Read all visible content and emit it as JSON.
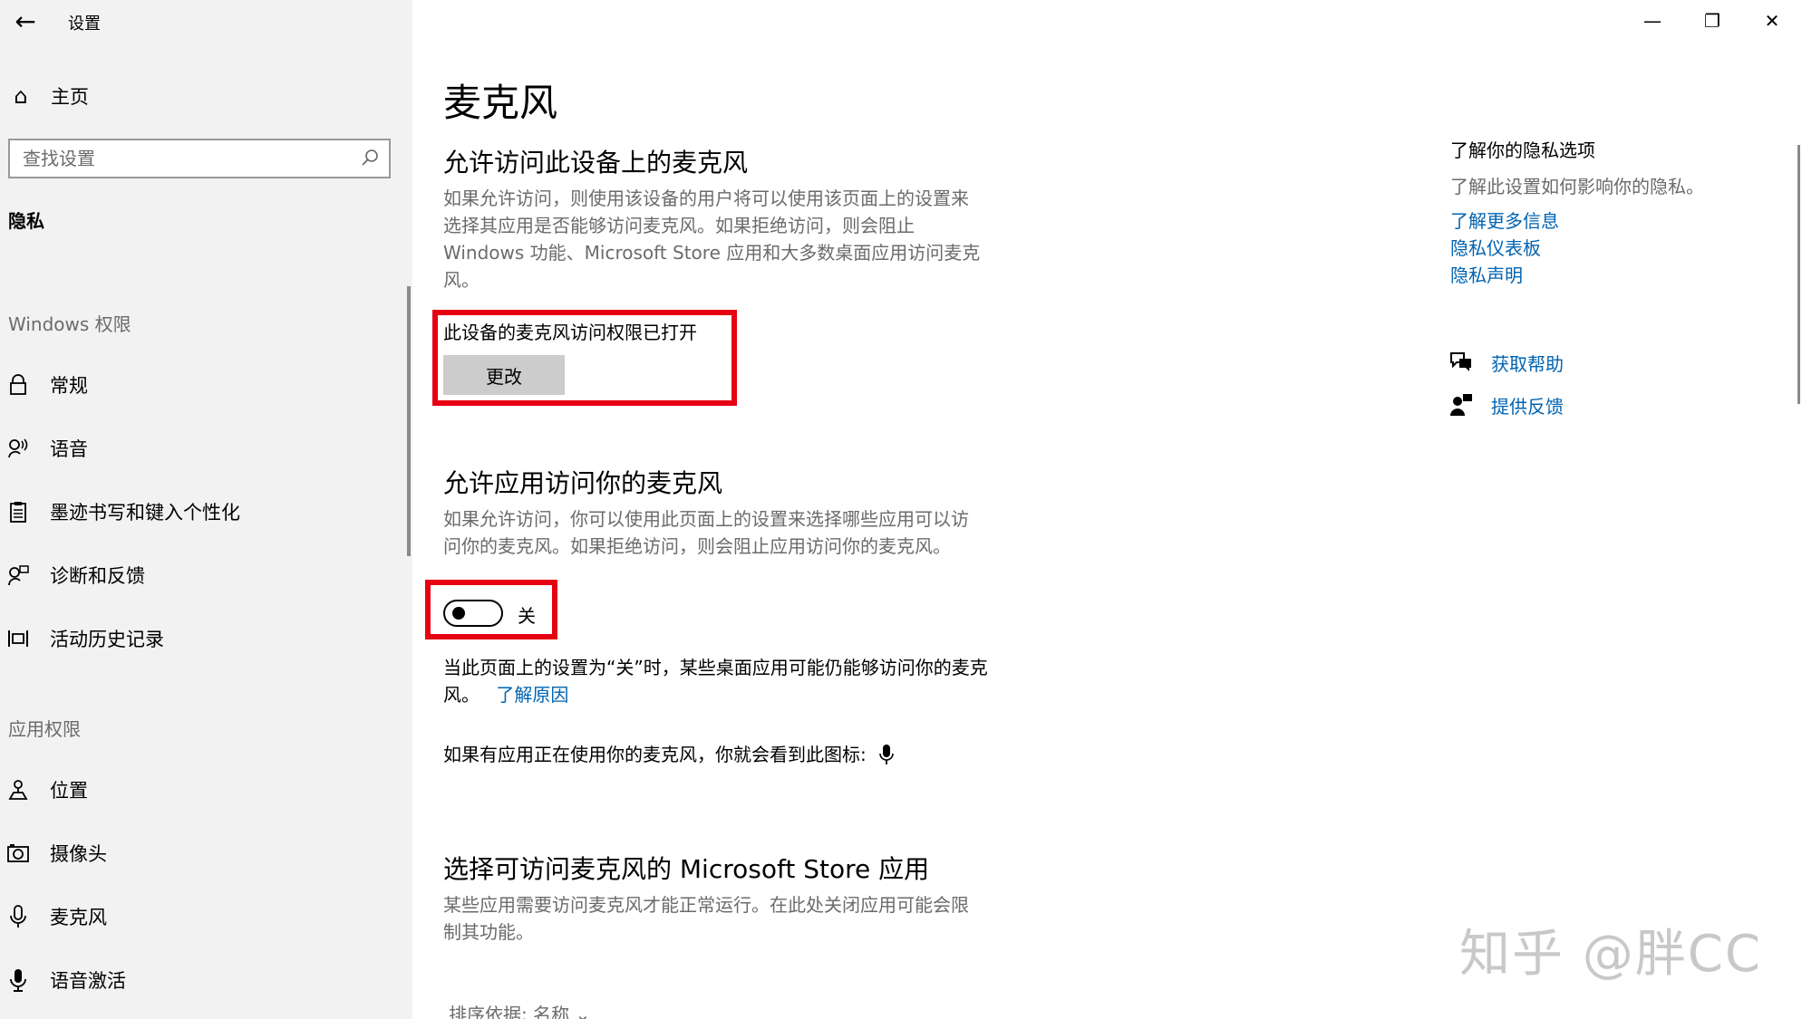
{
  "window": {
    "app_title": "设置",
    "controls": {
      "minimize": "—",
      "restore": "❐",
      "close": "✕"
    }
  },
  "sidebar": {
    "home_label": "主页",
    "search_placeholder": "查找设置",
    "current_category": "隐私",
    "section_windows": "Windows 权限",
    "windows_items": [
      {
        "label": "常规",
        "icon": "lock-icon"
      },
      {
        "label": "语音",
        "icon": "speech-icon"
      },
      {
        "label": "墨迹书写和键入个性化",
        "icon": "clipboard-icon"
      },
      {
        "label": "诊断和反馈",
        "icon": "feedback-person-icon"
      },
      {
        "label": "活动历史记录",
        "icon": "timeline-icon"
      }
    ],
    "section_apps": "应用权限",
    "app_items": [
      {
        "label": "位置",
        "icon": "location-icon"
      },
      {
        "label": "摄像头",
        "icon": "camera-icon"
      },
      {
        "label": "麦克风",
        "icon": "microphone-icon"
      },
      {
        "label": "语音激活",
        "icon": "voice-activation-icon"
      }
    ]
  },
  "main": {
    "title": "麦克风",
    "device": {
      "heading": "允许访问此设备上的麦克风",
      "description_lines": [
        "如果允许访问，则使用该设备的用户将可以使用该页面上的设置来",
        "选择其应用是否能够访问麦克风。如果拒绝访问，则会阻止",
        "Windows 功能、Microsoft Store 应用和大多数桌面应用访问麦克",
        "风。"
      ],
      "status": "此设备的麦克风访问权限已打开",
      "change_button": "更改"
    },
    "apps": {
      "heading": "允许应用访问你的麦克风",
      "description_lines": [
        "如果允许访问，你可以使用此页面上的设置来选择哪些应用可以访",
        "问你的麦克风。如果拒绝访问，则会阻止应用访问你的麦克风。"
      ],
      "toggle_state": "关",
      "toggle_on": false,
      "note_line1": "当此页面上的设置为“关”时，某些桌面应用可能仍能够访问你的麦克",
      "note_line2_prefix": "风。",
      "note_link": "了解原因",
      "indicator_text": "如果有应用正在使用你的麦克风，你就会看到此图标:"
    },
    "store": {
      "heading": "选择可访问麦克风的 Microsoft Store 应用",
      "description_lines": [
        "某些应用需要访问麦克风才能正常运行。在此处关闭应用可能会限",
        "制其功能。"
      ],
      "sort_label": "排序依据: 名称"
    }
  },
  "right": {
    "title": "了解你的隐私选项",
    "description": "了解此设置如何影响你的隐私。",
    "links": [
      "了解更多信息",
      "隐私仪表板",
      "隐私声明"
    ],
    "get_help": "获取帮助",
    "give_feedback": "提供反馈"
  },
  "watermark": "知乎 @胖CC",
  "colors": {
    "highlight_box": "#e60012",
    "link": "#0063b1",
    "sidebar_bg": "#f2f2f2"
  }
}
